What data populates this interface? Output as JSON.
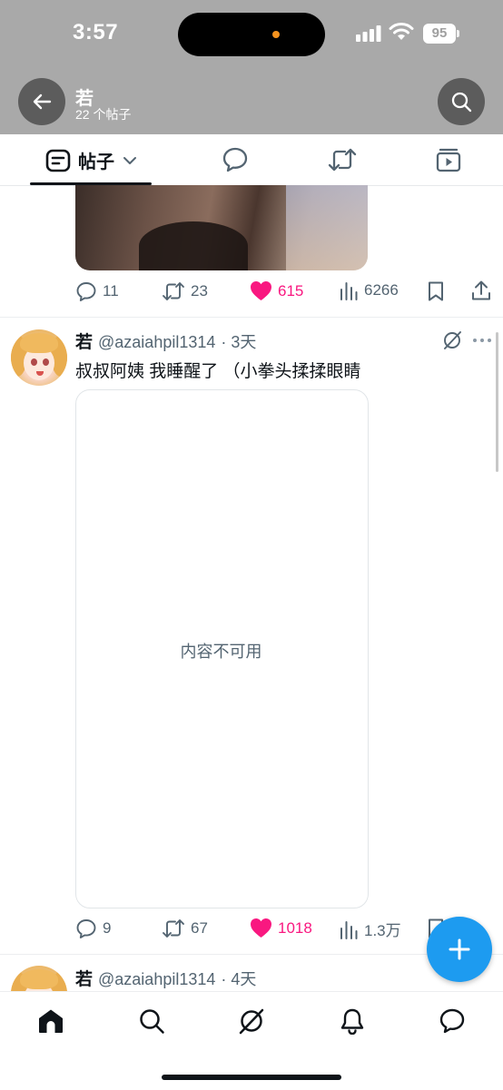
{
  "status_bar": {
    "time": "3:57",
    "battery": "95"
  },
  "header": {
    "name": "若",
    "post_count": "22 个帖子"
  },
  "tabs": {
    "posts_label": "帖子"
  },
  "post1": {
    "replies": "11",
    "reposts": "23",
    "likes": "615",
    "views": "6266"
  },
  "post2": {
    "name": "若",
    "handle": "@azaiahpil1314",
    "time": "· 3天",
    "text": "叔叔阿姨 我睡醒了 （小拳头揉揉眼睛",
    "media_unavailable": "内容不可用",
    "replies": "9",
    "reposts": "67",
    "likes": "1018",
    "views": "1.3万"
  },
  "post3": {
    "name": "若",
    "handle": "@azaiahpil1314",
    "time": "· 4天"
  },
  "colors": {
    "accent": "#1d9bf0",
    "like": "#f91880",
    "text": "#0f1419",
    "secondary": "#536471"
  },
  "icons": [
    "back-arrow-icon",
    "search-icon",
    "posts-icon",
    "chevron-down-icon",
    "replies-tab-icon",
    "reposts-tab-icon",
    "media-tab-icon",
    "reply-icon",
    "repost-icon",
    "heart-icon",
    "views-icon",
    "bookmark-icon",
    "share-icon",
    "grok-icon",
    "more-icon",
    "plus-icon",
    "home-icon",
    "explore-icon",
    "notifications-icon",
    "messages-icon"
  ]
}
